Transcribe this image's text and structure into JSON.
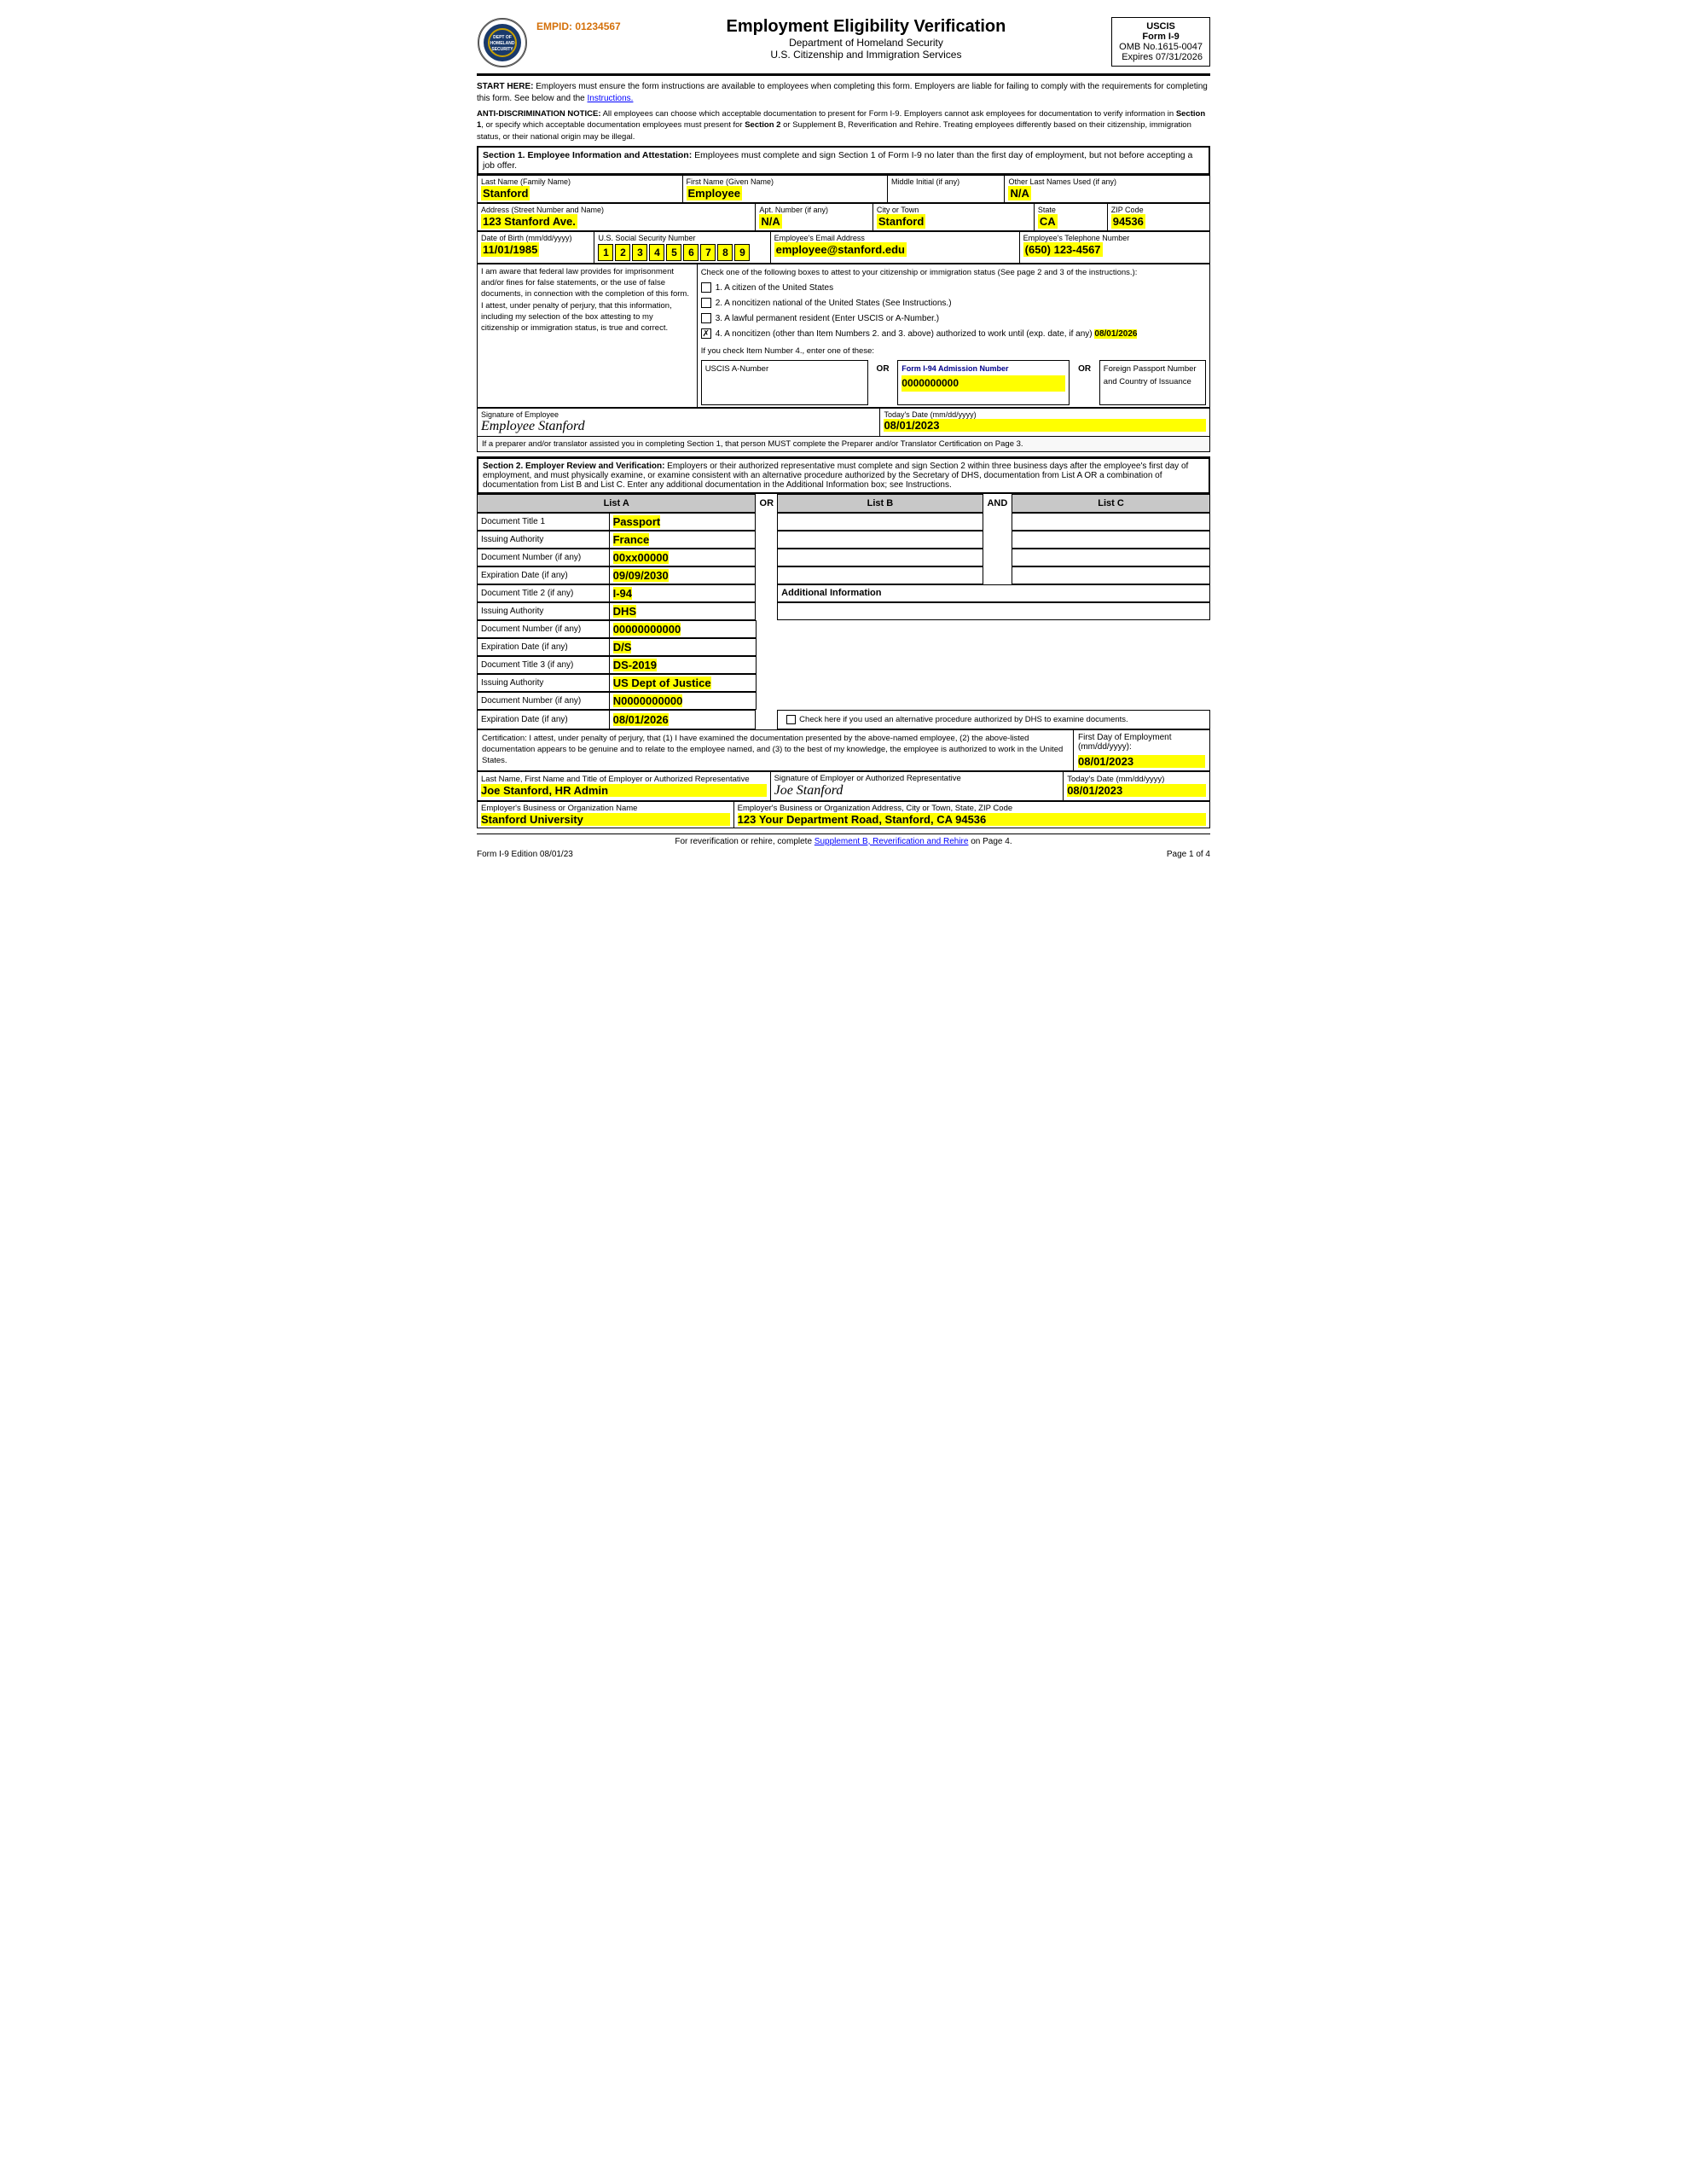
{
  "header": {
    "empid_label": "EMPID: 01234567",
    "title": "Employment Eligibility Verification",
    "subtitle1": "Department of Homeland Security",
    "subtitle2": "U.S. Citizenship and Immigration Services",
    "uscis": "USCIS",
    "form_number": "Form I-9",
    "omb": "OMB No.1615-0047",
    "expires": "Expires 07/31/2026"
  },
  "notices": {
    "start_here": "START HERE:  Employers must ensure the form instructions are available to employees when completing this form.  Employers are liable for failing to comply with the requirements for completing this form.  See below and the Instructions.",
    "anti_disc": "ANTI-DISCRIMINATION NOTICE:  All employees can choose which acceptable documentation to present for Form I-9.  Employers cannot ask employees for documentation to verify information in Section 1, or specify which acceptable documentation employees must present for Section 2 or Supplement B, Reverification and Rehire.  Treating employees differently based on their citizenship, immigration status, or their national origin may be illegal."
  },
  "section1": {
    "header": "Section 1. Employee Information and Attestation:",
    "header_text": " Employees must complete and sign Section 1 of Form I-9 no later than the first day of employment, but not before accepting a job offer.",
    "last_name_label": "Last Name (Family Name)",
    "last_name": "Stanford",
    "first_name_label": "First Name (Given Name)",
    "first_name": "Employee",
    "middle_label": "Middle Initial (if any)",
    "middle": "",
    "other_names_label": "Other Last Names Used (if any)",
    "other_names": "N/A",
    "address_label": "Address (Street Number and Name)",
    "address": "123 Stanford Ave.",
    "apt_label": "Apt. Number (if any)",
    "apt": "N/A",
    "city_label": "City or Town",
    "city": "Stanford",
    "state_label": "State",
    "state": "CA",
    "zip_label": "ZIP Code",
    "zip": "94536",
    "dob_label": "Date of Birth (mm/dd/yyyy)",
    "dob": "11/01/1985",
    "ssn_label": "U.S. Social Security Number",
    "ssn_digits": [
      "1",
      "2",
      "3",
      "4",
      "5",
      "6",
      "7",
      "8",
      "9"
    ],
    "email_label": "Employee's Email Address",
    "email": "employee@stanford.edu",
    "phone_label": "Employee's Telephone Number",
    "phone": "(650) 123-4567",
    "attest_text": "I am aware that federal law provides for imprisonment and/or fines for false statements, or the use of false documents, in connection with the completion of this form. I attest, under penalty of perjury, that this information, including my selection of the box attesting to my citizenship or immigration status, is true and correct.",
    "checkbox1": "1.  A citizen of the United States",
    "checkbox2": "2.  A noncitizen national of the United States (See Instructions.)",
    "checkbox3": "3.  A lawful permanent resident (Enter USCIS or A-Number.)",
    "checkbox4": "4.  A noncitizen (other than Item Numbers 2. and 3. above) authorized to work until (exp. date, if any)",
    "checkbox4_date": "08/01/2026",
    "checked_item": 4,
    "item4_note": "If you check Item Number 4., enter one of these:",
    "uscis_a_label": "USCIS A-Number",
    "or1": "OR",
    "i94_label": "Form I-94 Admission Number",
    "i94_value": "0000000000",
    "or2": "OR",
    "passport_label": "Foreign Passport Number and Country of Issuance",
    "sig_label": "Signature of Employee",
    "sig_value": "Employee Stanford",
    "date_label": "Today's Date (mm/dd/yyyy)",
    "date_value": "08/01/2023",
    "preparer_note": "If a preparer and/or translator assisted you in completing Section 1, that person MUST complete the Preparer and/or Translator Certification on Page 3."
  },
  "section2": {
    "header": "Section 2. Employer Review and Verification:",
    "header_text": " Employers or their authorized representative must complete and sign Section 2 within three business days after the employee's first day of employment, and must physically examine, or examine consistent with an alternative procedure authorized by the Secretary of DHS, documentation from List A OR a combination of documentation from List B and List C.  Enter any additional documentation in the Additional Information box; see Instructions.",
    "col_a": "List A",
    "col_or": "OR",
    "col_b": "List B",
    "col_and": "AND",
    "col_c": "List C",
    "doc_title1_label": "Document Title 1",
    "doc_title1": "Passport",
    "issuing_auth1_label": "Issuing Authority",
    "issuing_auth1": "France",
    "doc_num1_label": "Document Number (if any)",
    "doc_num1": "00xx00000",
    "exp_date1_label": "Expiration Date (if any)",
    "exp_date1": "09/09/2030",
    "doc_title2_label": "Document Title 2 (if any)",
    "doc_title2": "I-94",
    "add_info_label": "Additional Information",
    "issuing_auth2_label": "Issuing Authority",
    "issuing_auth2": "DHS",
    "doc_num2_label": "Document Number (if any)",
    "doc_num2": "00000000000",
    "exp_date2_label": "Expiration Date (if any)",
    "exp_date2": "D/S",
    "doc_title3_label": "Document Title 3 (if any)",
    "doc_title3": "DS-2019",
    "issuing_auth3_label": "Issuing Authority",
    "issuing_auth3": "US Dept of Justice",
    "doc_num3_label": "Document Number (if any)",
    "doc_num3": "N0000000000",
    "exp_date3_label": "Expiration Date (if any)",
    "exp_date3": "08/01/2026",
    "alt_proc_text": "Check here if you used an alternative procedure authorized by DHS to examine documents.",
    "cert_text": "Certification: I attest, under penalty of perjury, that (1) I have examined the documentation presented by the above-named employee, (2) the above-listed documentation appears to be genuine and to relate to the employee named, and (3) to the best of my knowledge, the employee is authorized to work in the United States.",
    "first_day_label": "First Day of Employment (mm/dd/yyyy):",
    "first_day": "08/01/2023",
    "rep_name_label": "Last Name, First Name and Title of Employer or Authorized Representative",
    "rep_name": "Joe Stanford, HR Admin",
    "rep_sig_label": "Signature of Employer or Authorized Representative",
    "rep_sig": "Joe Stanford",
    "rep_date_label": "Today's Date (mm/dd/yyyy)",
    "rep_date": "08/01/2023",
    "org_name_label": "Employer's Business or Organization Name",
    "org_name": "Stanford University",
    "org_addr_label": "Employer's Business or Organization Address, City or Town, State, ZIP Code",
    "org_addr": "123 Your Department Road, Stanford, CA 94536"
  },
  "footer": {
    "rehire_note": "For reverification or rehire, complete",
    "rehire_link": "Supplement B, Reverification and Rehire",
    "rehire_suffix": "on Page 4.",
    "edition": "Form I-9  Edition  08/01/23",
    "page": "Page 1 of 4"
  }
}
